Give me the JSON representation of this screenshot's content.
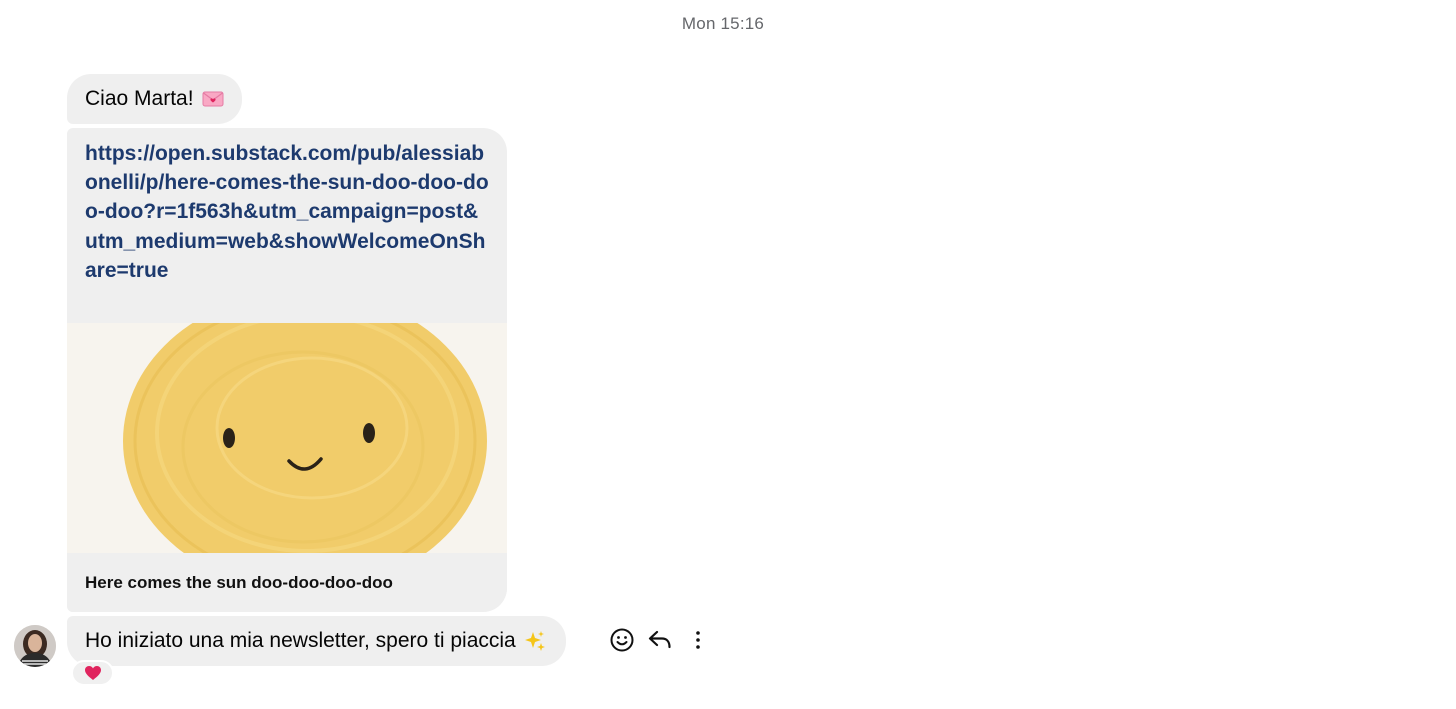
{
  "conversation": {
    "timestamp": "Mon 15:16",
    "messages": [
      {
        "type": "text",
        "text": "Ciao Marta!",
        "emoji": "love-letter-icon"
      },
      {
        "type": "link",
        "url": "https://open.substack.com/pub/alessiabonelli/p/here-comes-the-sun-doo-doo-doo-doo?r=1f563h&utm_campaign=post&utm_medium=web&showWelcomeOnShare=true",
        "preview_title": "Here comes the sun doo-doo-doo-doo",
        "preview_image": "smiling-sun-drawing"
      },
      {
        "type": "text",
        "text": "Ho iniziato una mia newsletter, spero ti piaccia",
        "emoji": "sparkles-icon",
        "reaction": "red-heart-icon"
      }
    ],
    "actions": [
      "react-emoji-icon",
      "reply-icon",
      "more-options-icon"
    ]
  },
  "colors": {
    "bubble": "#efefef",
    "link": "#1d3a6e",
    "timestamp": "#65676b",
    "sun": "#f2cf6e",
    "heart": "#e0245e"
  }
}
